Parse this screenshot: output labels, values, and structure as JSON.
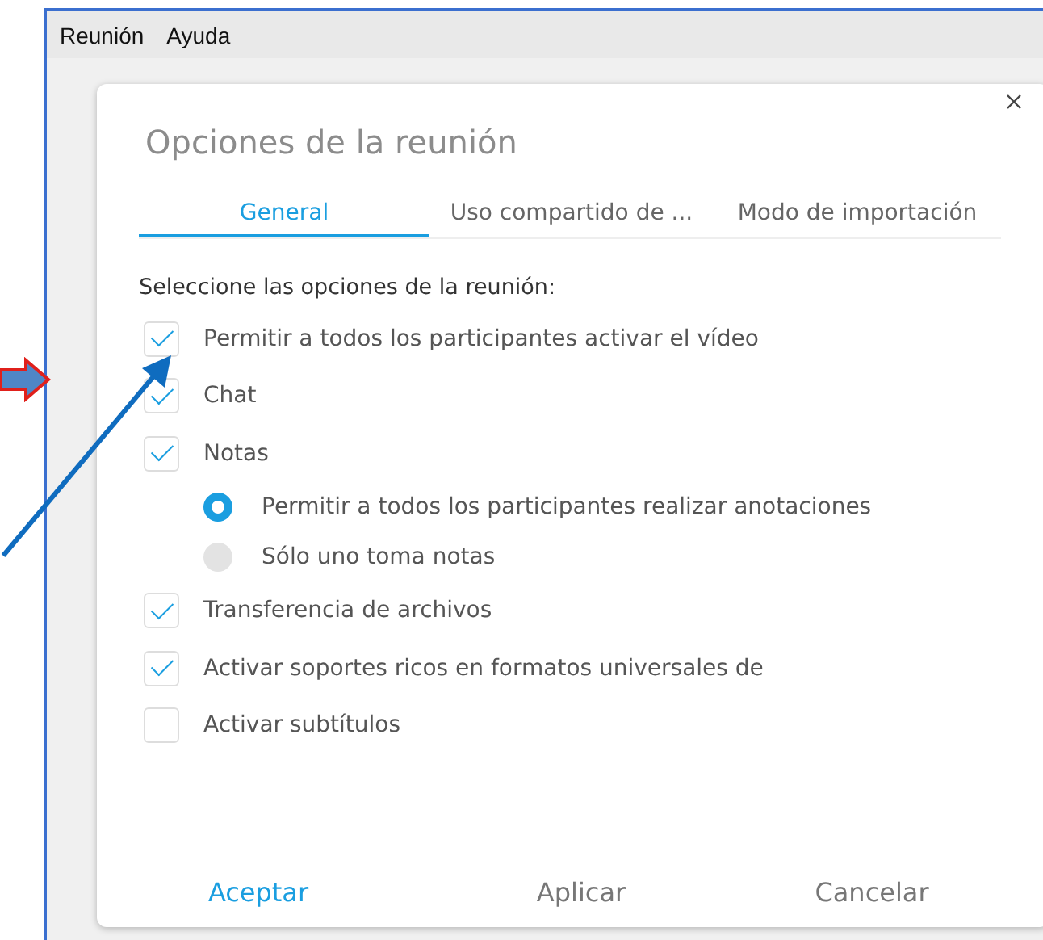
{
  "menu": [
    {
      "label": "Reunión"
    },
    {
      "label": "Ayuda"
    }
  ],
  "dialog": {
    "title": "Opciones de la reunión",
    "tabs": [
      {
        "label": "General",
        "selected": true
      },
      {
        "label": "Uso compartido de ...",
        "selected": false
      },
      {
        "label": "Modo de importación",
        "selected": false
      }
    ],
    "heading": "Seleccione las opciones de la reunión:",
    "options": [
      {
        "kind": "checkbox",
        "label": "Permitir a todos los participantes activar el vídeo",
        "checked": true
      },
      {
        "kind": "checkbox",
        "label": "Chat",
        "checked": true
      },
      {
        "kind": "checkbox",
        "label": "Notas",
        "checked": true,
        "children": [
          {
            "kind": "radio",
            "label": "Permitir a todos los participantes realizar anotaciones",
            "selected": true
          },
          {
            "kind": "radio",
            "label": "Sólo uno toma notas",
            "selected": false
          }
        ]
      },
      {
        "kind": "checkbox",
        "label": "Transferencia de archivos",
        "checked": true
      },
      {
        "kind": "checkbox",
        "label": "Activar soportes ricos en formatos universales de",
        "checked": true
      },
      {
        "kind": "checkbox",
        "label": "Activar subtítulos",
        "checked": false
      }
    ],
    "buttons": [
      {
        "label": "Aceptar",
        "primary": true
      },
      {
        "label": "Aplicar",
        "primary": false
      },
      {
        "label": "Cancelar",
        "primary": false
      }
    ]
  }
}
